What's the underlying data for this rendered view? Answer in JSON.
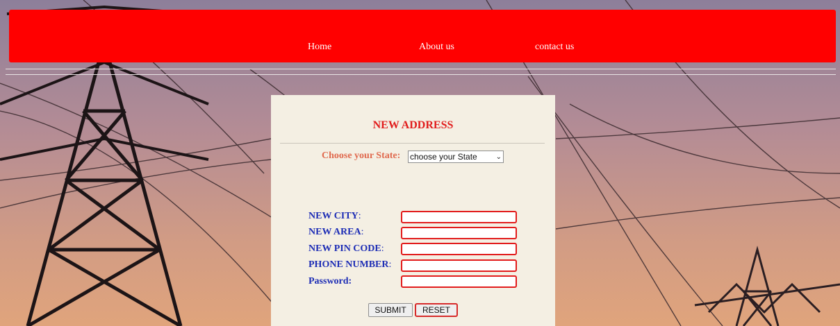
{
  "nav": {
    "links": [
      "Home",
      "About us",
      "contact us"
    ]
  },
  "form": {
    "title": "NEW ADDRESS",
    "state_label": "Choose your State:",
    "state_selected": "choose your State",
    "fields": {
      "city": "NEW CITY",
      "area": "NEW AREA",
      "pin": "NEW PIN CODE",
      "phone": "PHONE NUMBER",
      "password": "Password:"
    },
    "submit_label": "SUBMIT",
    "reset_label": "RESET"
  },
  "colors": {
    "navbar": "#ff0000",
    "panel": "#f4efe3",
    "title": "#e11d1d",
    "field_label": "#1d2db5",
    "state_label": "#e06a4f",
    "input_border": "#e21b1b"
  }
}
